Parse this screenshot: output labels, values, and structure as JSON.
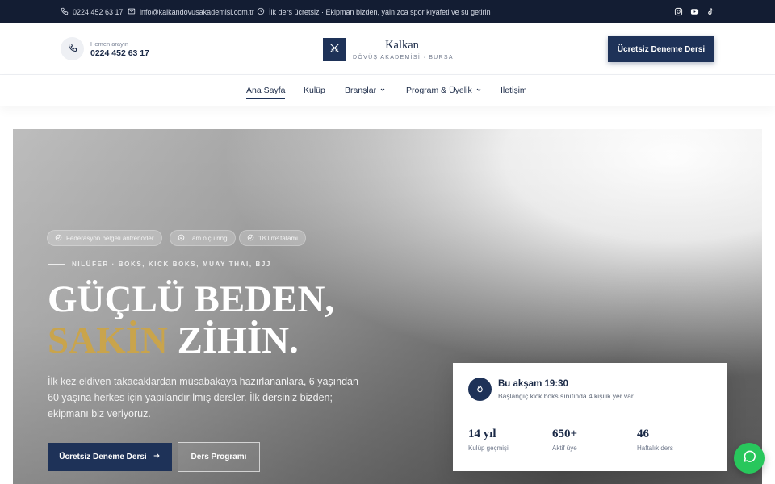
{
  "topbar": {
    "phone": "0224 452 63 17",
    "email": "info@kalkandovusakademisi.com.tr",
    "notice": "İlk ders ücretsiz · Ekipman bizden, yalnızca spor kıyafeti ve su getirin",
    "social_icons": [
      "instagram-icon",
      "youtube-icon",
      "tiktok-icon"
    ]
  },
  "header": {
    "call_hint": "Hemen arayın",
    "call_number": "0224 452 63 17",
    "logo_name": "Kalkan",
    "logo_subtitle": "DÖVÜŞ AKADEMİSİ · BURSA",
    "cta_label": "Ücretsiz Deneme Dersi"
  },
  "nav": {
    "items": [
      {
        "label": "Ana Sayfa",
        "active": true
      },
      {
        "label": "Kulüp"
      },
      {
        "label": "Branşlar",
        "has_dropdown": true
      },
      {
        "label": "Program & Üyelik",
        "has_dropdown": true
      },
      {
        "label": "İletişim"
      }
    ]
  },
  "hero": {
    "badges": [
      "Federasyon belgeli antrenörler",
      "Tam ölçü ring",
      "180 m² tatami"
    ],
    "eyebrow": "NİLÜFER · BOKS, KİCK BOKS, MUAY THAİ, BJJ",
    "headline_line1": "GÜÇLÜ BEDEN,",
    "headline_gold": "SAKİN",
    "headline_rest": "ZİHİN.",
    "description": "İlk kez eldiven takacaklardan müsabakaya hazırlananlara, 6 yaşından 60 yaşına herkes için yapılandırılmış dersler. İlk dersiniz bizden; ekipmanı biz veriyoruz.",
    "primary_button": "Ücretsiz Deneme Dersi",
    "secondary_button": "Ders Programı"
  },
  "info_card": {
    "title": "Bu akşam 19:30",
    "subtitle": "Başlangıç kick boks sınıfında 4 kişilik yer var.",
    "stats": [
      {
        "value": "14 yıl",
        "label": "Kulüp geçmişi"
      },
      {
        "value": "650+",
        "label": "Aktif üye"
      },
      {
        "value": "46",
        "label": "Haftalık ders"
      }
    ]
  },
  "colors": {
    "navy": "#1e3258",
    "topbar_bg": "#131d33",
    "gold": "#c9a44c",
    "whatsapp_green": "#28c75c"
  }
}
